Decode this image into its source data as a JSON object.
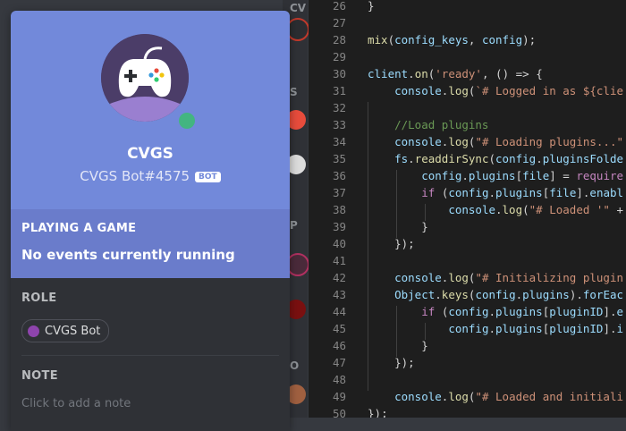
{
  "profile": {
    "display_name": "CVGS",
    "tag": "CVGS Bot#4575",
    "bot_badge": "BOT",
    "status_color": "#43b581",
    "activity_heading": "PLAYING A GAME",
    "activity_text": "No events currently running",
    "role_heading": "ROLE",
    "role_name": "CVGS Bot",
    "role_color": "#8e44ad",
    "note_heading": "NOTE",
    "note_placeholder": "Click to add a note",
    "avatar_icon": "gamepad-icon"
  },
  "member_list": {
    "letters": [
      "CV",
      "S",
      "P",
      "O"
    ]
  },
  "editor": {
    "lines": [
      {
        "n": "26",
        "code": "}"
      },
      {
        "n": "27",
        "code": ""
      },
      {
        "n": "28",
        "code": "mix(config_keys, config);"
      },
      {
        "n": "29",
        "code": ""
      },
      {
        "n": "30",
        "code": "client.on('ready', () => {"
      },
      {
        "n": "31",
        "code": "    console.log(`# Logged in as ${clie"
      },
      {
        "n": "32",
        "code": ""
      },
      {
        "n": "33",
        "code": "    //Load plugins"
      },
      {
        "n": "34",
        "code": "    console.log(\"# Loading plugins...\""
      },
      {
        "n": "35",
        "code": "    fs.readdirSync(config.pluginsFolde"
      },
      {
        "n": "36",
        "code": "        config.plugins[file] = require"
      },
      {
        "n": "37",
        "code": "        if (config.plugins[file].enabl"
      },
      {
        "n": "38",
        "code": "            console.log(\"# Loaded '\" +"
      },
      {
        "n": "39",
        "code": "        }"
      },
      {
        "n": "40",
        "code": "    });"
      },
      {
        "n": "41",
        "code": ""
      },
      {
        "n": "42",
        "code": "    console.log(\"# Initializing plugin"
      },
      {
        "n": "43",
        "code": "    Object.keys(config.plugins).forEac"
      },
      {
        "n": "44",
        "code": "        if (config.plugins[pluginID].e"
      },
      {
        "n": "45",
        "code": "            config.plugins[pluginID].i"
      },
      {
        "n": "46",
        "code": "        }"
      },
      {
        "n": "47",
        "code": "    });"
      },
      {
        "n": "48",
        "code": ""
      },
      {
        "n": "49",
        "code": "    console.log(\"# Loaded and initiali"
      },
      {
        "n": "50",
        "code": "});"
      }
    ]
  },
  "colors": {
    "accent": "#7289da",
    "editor_bg": "#1e1e1e"
  }
}
